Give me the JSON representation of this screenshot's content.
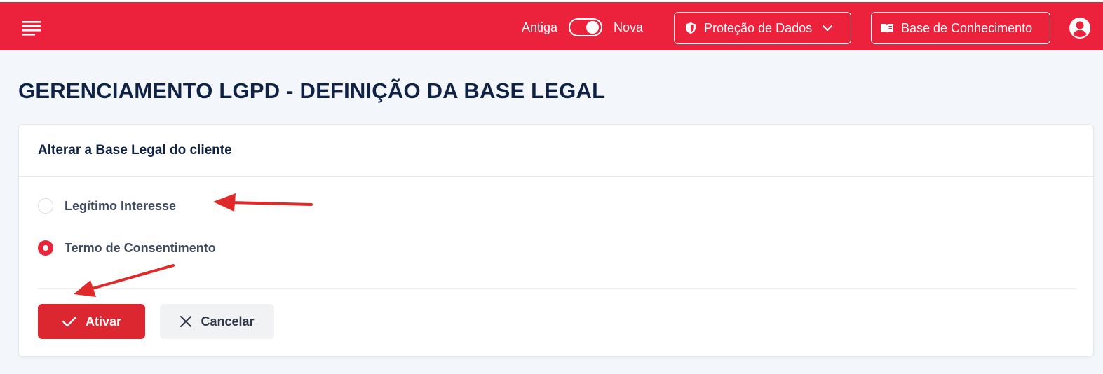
{
  "header": {
    "version_toggle": {
      "left_label": "Antiga",
      "right_label": "Nova",
      "state": "Nova"
    },
    "privacy_menu_label": "Proteção de Dados",
    "knowledge_base_label": "Base de Conhecimento",
    "icons": [
      "menu-icon",
      "shield-icon",
      "chevron-down-icon",
      "book-icon",
      "user-circle-icon"
    ]
  },
  "page": {
    "title": "GERENCIAMENTO LGPD - DEFINIÇÃO DA BASE LEGAL"
  },
  "card": {
    "title": "Alterar a Base Legal do cliente",
    "options": [
      {
        "label": "Legítimo Interesse",
        "selected": false
      },
      {
        "label": "Termo de Consentimento",
        "selected": true
      }
    ],
    "activate_label": "Ativar",
    "cancel_label": "Cancelar"
  },
  "colors": {
    "brand": "#ec213b",
    "activate": "#dc2630",
    "title_text": "#0f2144",
    "background": "#f3f6fb"
  }
}
